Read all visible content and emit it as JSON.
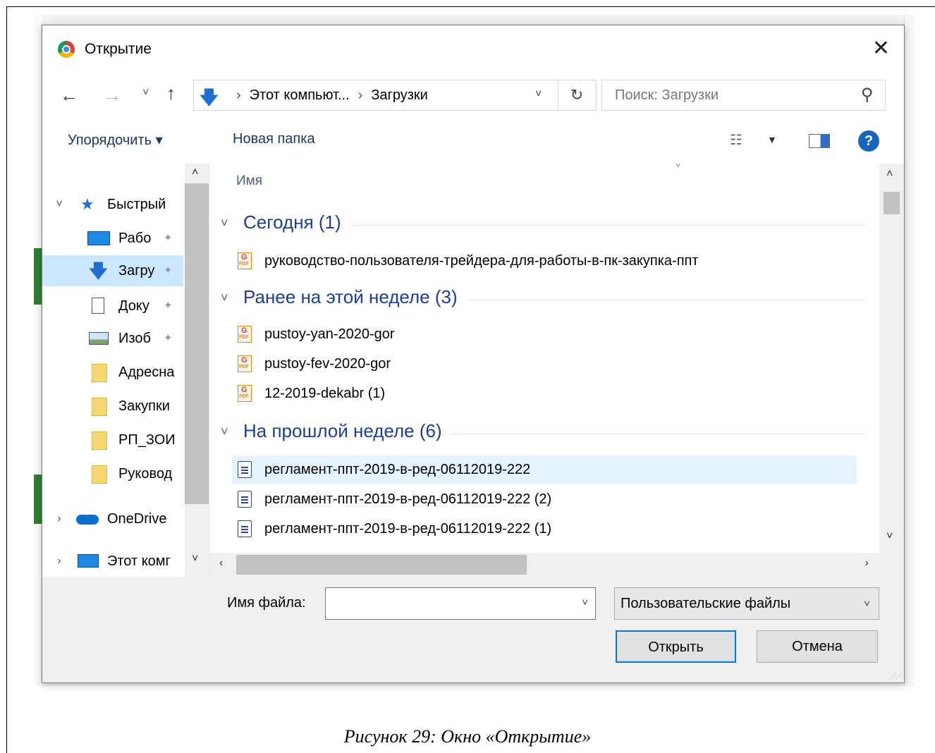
{
  "dialog": {
    "title": "Открытие",
    "close_glyph": "✕"
  },
  "nav": {
    "back": "←",
    "forward": "→",
    "recent": "˅",
    "up": "↑",
    "path": [
      "Этот компьют...",
      "Загрузки"
    ],
    "path_sep": "›",
    "dropdown": "˅",
    "refresh": "↻",
    "search_placeholder": "Поиск: Загрузки"
  },
  "toolbar": {
    "organize": "Упорядочить ▾",
    "new_folder": "Новая папка",
    "views_glyph": "☷",
    "views_arrow": "▼",
    "help": "?"
  },
  "sidebar": {
    "items": [
      {
        "label": "Быстрый",
        "icon": "star-icon",
        "pinned": false,
        "chevron": "˅"
      },
      {
        "label": "Рабо",
        "icon": "desktop-icon",
        "pinned": true
      },
      {
        "label": "Загру",
        "icon": "download-icon",
        "pinned": true,
        "selected": true
      },
      {
        "label": "Доку",
        "icon": "document-icon",
        "pinned": true
      },
      {
        "label": "Изоб",
        "icon": "image-icon",
        "pinned": true
      },
      {
        "label": "Адресна",
        "icon": "folder-icon",
        "pinned": false
      },
      {
        "label": "Закупки",
        "icon": "folder-icon",
        "pinned": false
      },
      {
        "label": "РП_ЗОИ",
        "icon": "folder-icon",
        "pinned": false
      },
      {
        "label": "Руковод",
        "icon": "folder-icon",
        "pinned": false
      },
      {
        "label": "OneDrive",
        "icon": "onedrive-icon",
        "pinned": false,
        "chevron": "›"
      },
      {
        "label": "Этот комг",
        "icon": "computer-icon",
        "pinned": false,
        "chevron": "›"
      }
    ],
    "pin_glyph": "📌"
  },
  "files": {
    "column_name": "Имя",
    "sort_glyph": "˅",
    "groups": [
      {
        "title": "Сегодня (1)",
        "files": [
          {
            "name": "руководство-пользователя-трейдера-для-работы-в-пк-закупка-ппт",
            "type": "pdf"
          }
        ]
      },
      {
        "title": "Ранее на этой неделе (3)",
        "files": [
          {
            "name": "pustoy-yan-2020-gor",
            "type": "pdf"
          },
          {
            "name": "pustoy-fev-2020-gor",
            "type": "pdf"
          },
          {
            "name": "12-2019-dekabr (1)",
            "type": "pdf"
          }
        ]
      },
      {
        "title": "На прошлой неделе (6)",
        "files": [
          {
            "name": "регламент-ппт-2019-в-ред-06112019-222",
            "type": "doc",
            "selected": true
          },
          {
            "name": "регламент-ппт-2019-в-ред-06112019-222 (2)",
            "type": "doc"
          },
          {
            "name": "регламент-ппт-2019-в-ред-06112019-222 (1)",
            "type": "doc"
          }
        ]
      }
    ],
    "group_chevron": "˅"
  },
  "bottom": {
    "filename_label": "Имя файла:",
    "filename_value": "",
    "filetype": "Пользовательские файлы",
    "open_label": "Открыть",
    "cancel_label": "Отмена"
  },
  "caption": "Рисунок 29: Окно «Открытие»"
}
